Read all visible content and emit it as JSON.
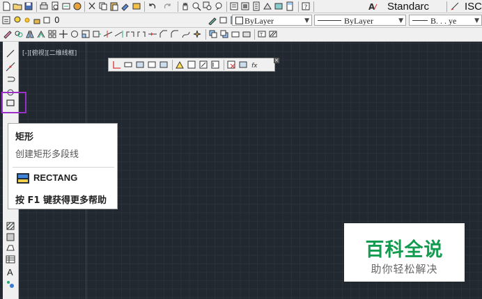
{
  "toolbar_row2": {
    "layer_value": "0",
    "color_combo": "ByLayer",
    "linetype_combo": "ByLayer",
    "lineweight_combo": "B. . . ye"
  },
  "toolbar_row1": {
    "text_style": "Standarc",
    "dim_style_partial": "ISC"
  },
  "viewport_label": "[-][俯视][二维线框]",
  "tooltip": {
    "title": "矩形",
    "description": "创建矩形多段线",
    "command": "RECTANG",
    "help": "按 F1 键获得更多帮助"
  },
  "watermark": {
    "title": "百科全说",
    "subtitle": "助你轻松解决"
  },
  "left_tools": [
    "line-icon",
    "construction-line-icon",
    "polyline-icon",
    "circle-icon",
    "rectangle-icon",
    "hatch-icon",
    "table-icon",
    "multiline-text-icon",
    "add-selected-icon"
  ],
  "colors": {
    "canvas": "#212830",
    "highlight": "#9b30c8",
    "watermark_green": "#139b50"
  }
}
